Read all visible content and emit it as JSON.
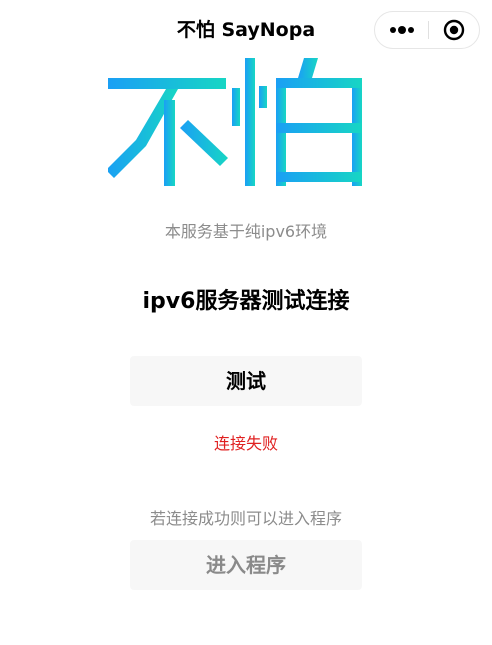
{
  "nav": {
    "title": "不怕 SayNopa",
    "more_icon": "more-dots-icon",
    "close_icon": "target-close-icon"
  },
  "logo": {
    "text": "不怕",
    "colors": {
      "left": "#1a9ff5",
      "right": "#17d6c4"
    }
  },
  "main": {
    "subtitle": "本服务基于纯ipv6环境",
    "heading": "ipv6服务器测试连接",
    "test_button_label": "测试",
    "status_text": "连接失败",
    "status_color": "#e02020",
    "hint": "若连接成功则可以进入程序",
    "enter_button_label": "进入程序"
  }
}
